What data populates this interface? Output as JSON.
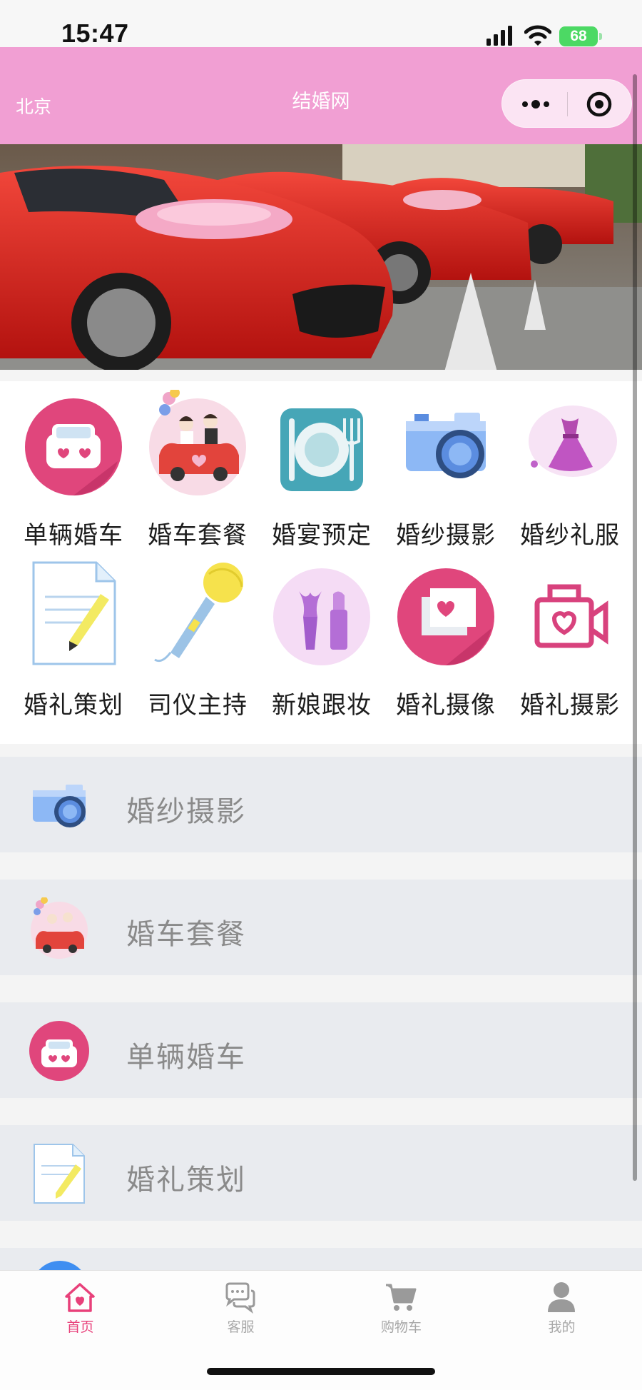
{
  "status_bar": {
    "time": "15:47",
    "battery": "68"
  },
  "nav": {
    "city": "北京",
    "title": "结婚网"
  },
  "categories": [
    {
      "label": "单辆婚车",
      "icon": "car-icon"
    },
    {
      "label": "婚车套餐",
      "icon": "wedding-couple-car-icon"
    },
    {
      "label": "婚宴预定",
      "icon": "plate-cutlery-icon"
    },
    {
      "label": "婚纱摄影",
      "icon": "camera-icon"
    },
    {
      "label": "婚纱礼服",
      "icon": "dress-icon"
    },
    {
      "label": "婚礼策划",
      "icon": "document-pencil-icon"
    },
    {
      "label": "司仪主持",
      "icon": "microphone-icon"
    },
    {
      "label": "新娘跟妆",
      "icon": "makeup-icon"
    },
    {
      "label": "婚礼摄像",
      "icon": "photo-heart-icon"
    },
    {
      "label": "婚礼摄影",
      "icon": "video-camera-heart-icon"
    }
  ],
  "list": [
    {
      "label": "婚纱摄影",
      "icon": "camera-icon"
    },
    {
      "label": "婚车套餐",
      "icon": "wedding-couple-car-icon"
    },
    {
      "label": "单辆婚车",
      "icon": "car-icon"
    },
    {
      "label": "婚礼策划",
      "icon": "document-pencil-icon"
    }
  ],
  "tabs": [
    {
      "label": "首页",
      "icon": "home-icon",
      "active": true
    },
    {
      "label": "客服",
      "icon": "chat-icon",
      "active": false
    },
    {
      "label": "购物车",
      "icon": "cart-icon",
      "active": false
    },
    {
      "label": "我的",
      "icon": "user-icon",
      "active": false
    }
  ],
  "colors": {
    "header": "#f19fd3",
    "active_tab": "#e8407a",
    "list_bg": "#e9ebef"
  }
}
